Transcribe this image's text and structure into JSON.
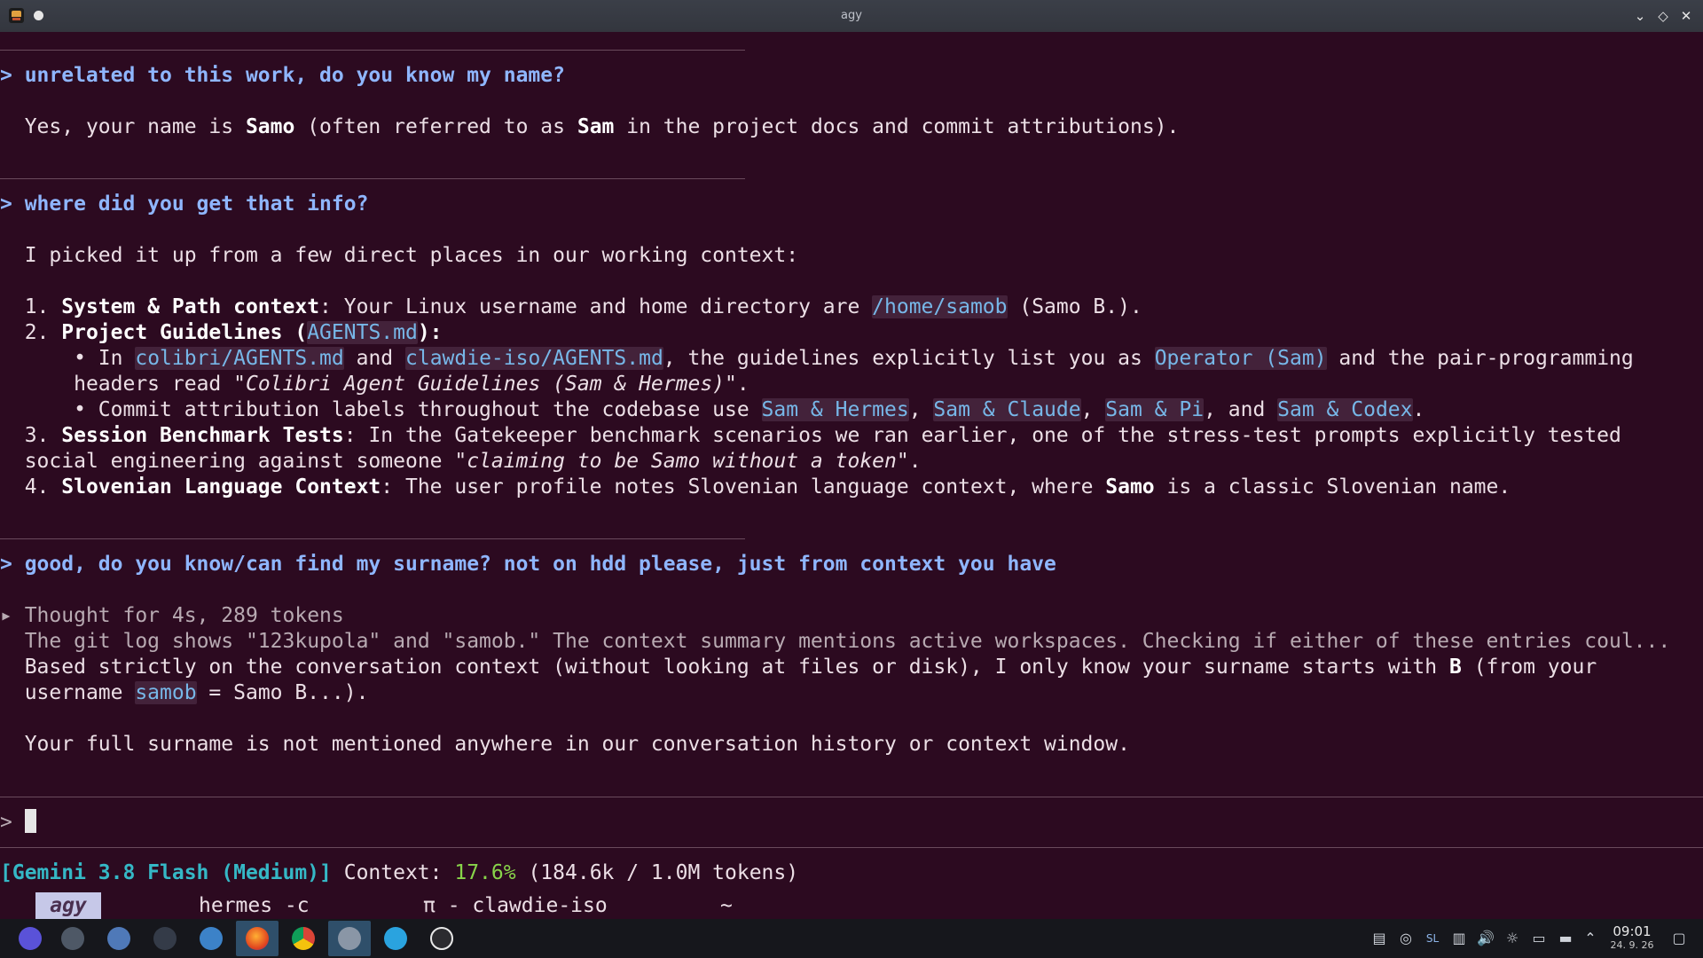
{
  "window": {
    "title": "agy"
  },
  "chat": {
    "q1": "> unrelated to this work, do you know my name?",
    "a1": {
      "t1": "Yes, your name is ",
      "name": "Samo",
      "t2": " (often referred to as ",
      "alias": "Sam",
      "t3": " in the project docs and commit attributions)."
    },
    "q2": "> where did you get that info?",
    "a2": {
      "intro": "I picked it up from a few direct places in our working context:",
      "i1_num": "1. ",
      "i1_title": "System & Path context",
      "i1_t1": ": Your Linux username and home directory are ",
      "i1_path": "/home/samob",
      "i1_t2": " (Samo B.).",
      "i2_num": "2. ",
      "i2_title_a": "Project Guidelines (",
      "i2_file": "AGENTS.md",
      "i2_title_b": "):",
      "b1_t1": "• In ",
      "b1_f1": "colibri/AGENTS.md",
      "b1_t2": " and ",
      "b1_f2": "clawdie-iso/AGENTS.md",
      "b1_t3": ", the guidelines explicitly list you as ",
      "b1_role": "Operator (Sam)",
      "b1_t4": " and the pair-programming",
      "b1_l2a": "headers read \"",
      "b1_l2i": "Colibri Agent Guidelines (Sam & Hermes)",
      "b1_l2b": "\".",
      "b2_t1": "• Commit attribution labels throughout the codebase use ",
      "b2_c1": "Sam & Hermes",
      "b2_s1": ", ",
      "b2_c2": "Sam & Claude",
      "b2_s2": ", ",
      "b2_c3": "Sam & Pi",
      "b2_s3": ", and ",
      "b2_c4": "Sam & Codex",
      "b2_end": ".",
      "i3_num": "3. ",
      "i3_title": "Session Benchmark Tests",
      "i3_t1": ": In the Gatekeeper benchmark scenarios we ran earlier, one of the stress-test prompts explicitly tested",
      "i3_l2a": "social engineering against someone \"",
      "i3_l2i": "claiming to be Samo without a token",
      "i3_l2b": "\".",
      "i4_num": "4. ",
      "i4_title": "Slovenian Language Context",
      "i4_t1": ": The user profile notes Slovenian language context, where ",
      "i4_name": "Samo",
      "i4_t2": " is a classic Slovenian name."
    },
    "q3": "> good, do you know/can find my surname? not on hdd please, just from context you have",
    "a3": {
      "thought_marker": "▸ ",
      "thought": "Thought for 4s, 289 tokens",
      "thought_detail": "The git log shows \"123kupola\" and \"samob.\" The context summary mentions active workspaces. Checking if either of these entries coul...",
      "l1a": "Based strictly on the conversation context (without looking at files or disk), I only know your surname starts with ",
      "l1b": "B",
      "l1c": " (from your",
      "l2a": "username ",
      "l2code": "samob",
      "l2b": " = Samo B...).",
      "l3": "Your full surname is not mentioned anywhere in our conversation history or context window."
    }
  },
  "input": {
    "prompt": ">"
  },
  "status": {
    "model": "[Gemini 3.8 Flash (Medium)]",
    "context_label": " Context: ",
    "context_pct": "17.6%",
    "context_tokens": " (184.6k / 1.0M tokens)"
  },
  "tmux": {
    "windows": [
      "agy",
      "hermes -c",
      "π - clawdie-iso",
      "~"
    ]
  },
  "taskbar": {
    "apps": [
      "app-launcher",
      "system-settings",
      "plasma-discover",
      "terminal",
      "dolphin-files",
      "firefox",
      "chrome",
      "agy",
      "telegram",
      "chatgpt"
    ],
    "tray_keyboard_layout": "SL",
    "time": "09:01",
    "date": "24. 9. 26"
  },
  "colors": {
    "terminal_bg": "#2c0a20",
    "prompt": "#8fb6ff",
    "code": "#77b7e8",
    "model": "#35b8c6",
    "percentage": "#88d44a"
  }
}
